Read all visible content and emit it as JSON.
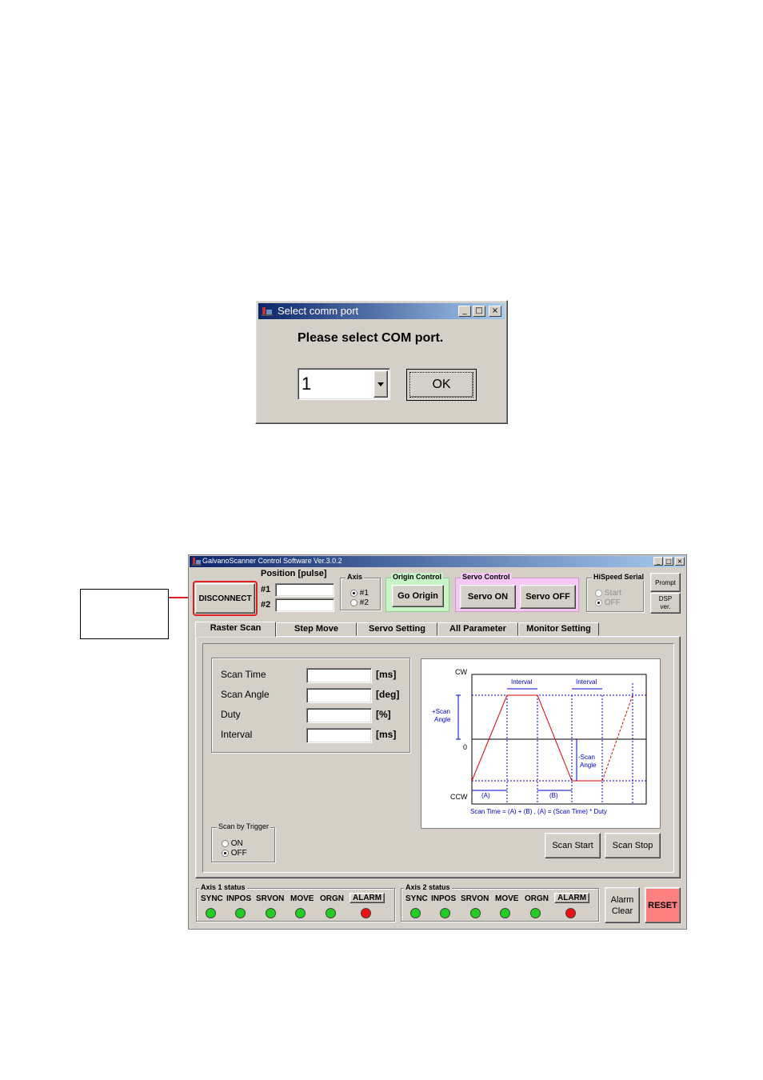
{
  "dialog": {
    "title": "Select comm port",
    "prompt": "Please select COM  port.",
    "port_value": "1",
    "ok_label": "OK"
  },
  "app": {
    "title": "GalvanoScanner Control Software Ver.3.0.2",
    "disconnect_label": "DISCONNECT",
    "position": {
      "title": "Position [pulse]",
      "axis1_label": "#1",
      "axis2_label": "#2",
      "axis1_value": "",
      "axis2_value": ""
    },
    "axis_group": {
      "title": "Axis",
      "opt1": "#1",
      "opt2": "#2"
    },
    "origin": {
      "title": "Origin Control",
      "button": "Go Origin"
    },
    "servo": {
      "title": "Servo Control",
      "on": "Servo ON",
      "off": "Servo OFF"
    },
    "hispeed": {
      "title": "HiSpeed Serial",
      "start": "Start",
      "off": "OFF"
    },
    "prompt_button": "Prompt",
    "dsp_line1": "DSP",
    "dsp_line2": "ver.",
    "tabs": [
      "Raster Scan",
      "Step Move",
      "Servo Setting",
      "All Parameter",
      "Monitor Setting"
    ],
    "params": [
      {
        "label": "Scan Time",
        "unit": "[ms]",
        "value": ""
      },
      {
        "label": "Scan Angle",
        "unit": "[deg]",
        "value": ""
      },
      {
        "label": "Duty",
        "unit": "[%]",
        "value": ""
      },
      {
        "label": "Interval",
        "unit": "[ms]",
        "value": ""
      }
    ],
    "diagram": {
      "cw": "CW",
      "zero": "0",
      "ccw": "CCW",
      "interval1": "Interval",
      "interval2": "Interval",
      "plus_scan_1": "+Scan",
      "plus_scan_2": "Angle",
      "minus_scan_1": "-Scan",
      "minus_scan_2": "Angle",
      "a_label": "(A)",
      "b_label": "(B)",
      "formula": "Scan Time = (A) + (B) ,   (A) = (Scan Time) * Duty"
    },
    "trigger": {
      "title": "Scan by Trigger",
      "on": "ON",
      "off": "OFF"
    },
    "scan_start": "Scan Start",
    "scan_stop": "Scan Stop",
    "axis1_status": {
      "title": "Axis 1 status",
      "labels": [
        "SYNC",
        "INPOS",
        "SRVON",
        "MOVE",
        "ORGN",
        "ALARM"
      ]
    },
    "axis2_status": {
      "title": "Axis 2 status",
      "labels": [
        "SYNC",
        "INPOS",
        "SRVON",
        "MOVE",
        "ORGN",
        "ALARM"
      ]
    },
    "alarm_clear_1": "Alarm",
    "alarm_clear_2": "Clear",
    "reset": "RESET"
  },
  "colors": {
    "led_ok": "#22cc22",
    "led_alarm": "#ee1111",
    "origin_bg": "#c8f5c8",
    "servo_bg": "#f5c8f5",
    "reset_bg": "#ff8080",
    "highlight": "#e02020"
  }
}
